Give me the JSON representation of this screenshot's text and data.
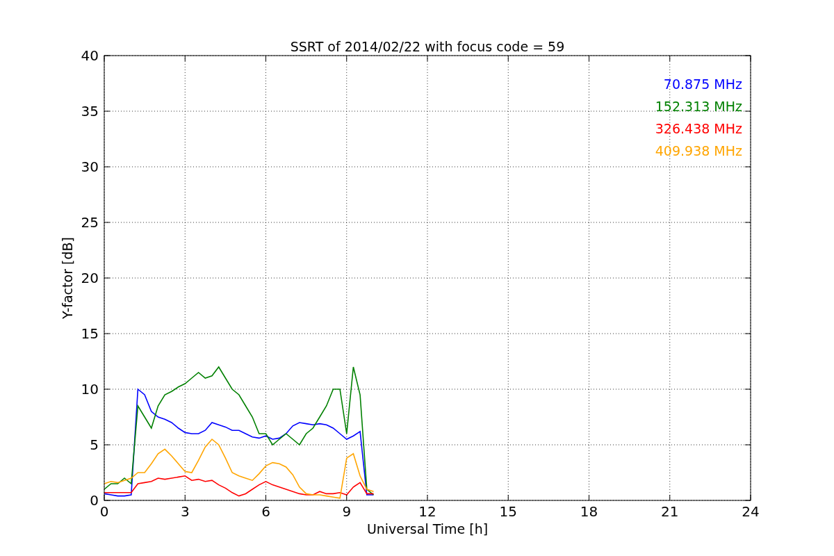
{
  "chart_data": {
    "type": "line",
    "title": "SSRT of 2014/02/22 with focus code = 59",
    "xlabel": "Universal Time [h]",
    "ylabel": "Y-factor [dB]",
    "x": [
      0,
      0.25,
      0.5,
      0.75,
      1,
      1.25,
      1.5,
      1.75,
      2,
      2.25,
      2.5,
      2.75,
      3,
      3.25,
      3.5,
      3.75,
      4,
      4.25,
      4.5,
      4.75,
      5,
      5.25,
      5.5,
      5.75,
      6,
      6.25,
      6.5,
      6.75,
      7,
      7.25,
      7.5,
      7.75,
      8,
      8.25,
      8.5,
      8.75,
      9,
      9.25,
      9.5,
      9.75,
      10
    ],
    "series": [
      {
        "name": "70.875 MHz",
        "color": "#0000ff",
        "values": [
          0.6,
          0.5,
          0.4,
          0.4,
          0.5,
          10,
          9.5,
          8,
          7.5,
          7.3,
          7,
          6.5,
          6.1,
          6,
          6,
          6.3,
          7,
          6.8,
          6.6,
          6.3,
          6.3,
          6,
          5.7,
          5.6,
          5.8,
          5.5,
          5.6,
          6,
          6.7,
          7,
          6.9,
          6.8,
          6.9,
          6.8,
          6.5,
          6,
          5.5,
          5.8,
          6.2,
          0.5,
          0.5
        ]
      },
      {
        "name": "152.313 MHz",
        "color": "#008000",
        "values": [
          1,
          1.5,
          1.5,
          2,
          1.5,
          8.5,
          7.5,
          6.5,
          8.5,
          9.5,
          9.8,
          10.2,
          10.5,
          11,
          11.5,
          11,
          11.2,
          12,
          11,
          10,
          9.5,
          8.5,
          7.5,
          6,
          6,
          5,
          5.5,
          6,
          5.5,
          5,
          6,
          6.5,
          7.5,
          8.5,
          10,
          10,
          6,
          12,
          9.5,
          1,
          0.5
        ]
      },
      {
        "name": "326.438 MHz",
        "color": "#ff0000",
        "values": [
          0.7,
          0.7,
          0.7,
          0.7,
          0.7,
          1.5,
          1.6,
          1.7,
          2,
          1.9,
          2,
          2.1,
          2.2,
          1.8,
          1.9,
          1.7,
          1.8,
          1.4,
          1.1,
          0.7,
          0.4,
          0.6,
          1,
          1.4,
          1.7,
          1.4,
          1.2,
          1,
          0.8,
          0.6,
          0.5,
          0.5,
          0.8,
          0.6,
          0.6,
          0.7,
          0.5,
          1.2,
          1.6,
          0.6,
          0.6
        ]
      },
      {
        "name": "409.938 MHz",
        "color": "#ffa500",
        "values": [
          1.5,
          1.7,
          1.6,
          1.8,
          2,
          2.5,
          2.5,
          3.3,
          4.2,
          4.6,
          4,
          3.3,
          2.6,
          2.5,
          3.6,
          4.8,
          5.5,
          5,
          3.8,
          2.5,
          2.2,
          2,
          1.8,
          2.4,
          3.1,
          3.4,
          3.3,
          3,
          2.3,
          1.2,
          0.6,
          0.5,
          0.5,
          0.4,
          0.3,
          0.2,
          3.8,
          4.2,
          2.2,
          1,
          0.8
        ]
      }
    ],
    "grid": true,
    "xlim": [
      0,
      24
    ],
    "ylim": [
      0,
      40
    ],
    "xticks": [
      0,
      3,
      6,
      9,
      12,
      15,
      18,
      21,
      24
    ],
    "yticks": [
      0,
      5,
      10,
      15,
      20,
      25,
      30,
      35,
      40
    ]
  }
}
